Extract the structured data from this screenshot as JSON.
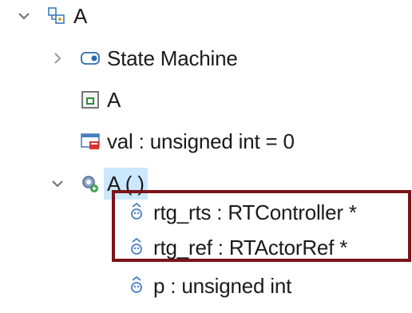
{
  "tree": {
    "root": {
      "label": "A",
      "icon": "class-icon",
      "expanded": true
    },
    "children": [
      {
        "label": "State Machine",
        "icon": "state-machine-icon",
        "expanded": false
      },
      {
        "label": "A",
        "icon": "capsule-structure-icon"
      },
      {
        "label": "val : unsigned int = 0",
        "icon": "attribute-icon"
      },
      {
        "label": "A ( )",
        "icon": "constructor-icon",
        "expanded": true,
        "selected": true,
        "children": [
          {
            "label": "rtg_rts : RTController *",
            "icon": "parameter-icon"
          },
          {
            "label": "rtg_ref : RTActorRef *",
            "icon": "parameter-icon"
          },
          {
            "label": "p : unsigned int",
            "icon": "parameter-icon"
          }
        ]
      }
    ]
  },
  "colors": {
    "selection_background": "#cce8ff",
    "highlight_border": "#7a1418",
    "chevron": "#6e6e6e",
    "text": "#1a1a1a"
  }
}
